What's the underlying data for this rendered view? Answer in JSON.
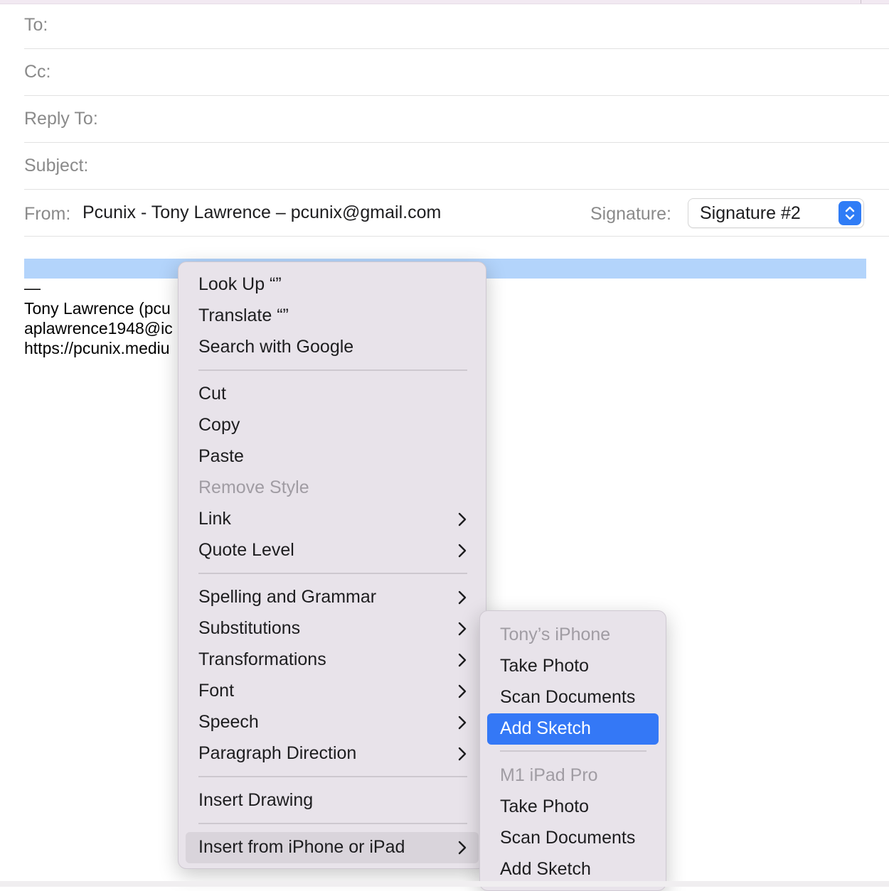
{
  "header": {
    "to_label": "To:",
    "cc_label": "Cc:",
    "reply_to_label": "Reply To:",
    "subject_label": "Subject:",
    "from_label": "From:",
    "from_value": "Pcunix - Tony Lawrence – pcunix@gmail.com",
    "signature_label": "Signature:",
    "signature_value": "Signature #2"
  },
  "body": {
    "dash": "—",
    "line1": "Tony Lawrence (pcu",
    "line2": "aplawrence1948@ic",
    "line3": "https://pcunix.mediu"
  },
  "context_menu": {
    "look_up": "Look Up “”",
    "translate": "Translate “”",
    "search_google": "Search with Google",
    "cut": "Cut",
    "copy": "Copy",
    "paste": "Paste",
    "remove_style": "Remove Style",
    "link": "Link",
    "quote_level": "Quote Level",
    "spelling": "Spelling and Grammar",
    "substitutions": "Substitutions",
    "transformations": "Transformations",
    "font": "Font",
    "speech": "Speech",
    "paragraph_direction": "Paragraph Direction",
    "insert_drawing": "Insert Drawing",
    "insert_iphone": "Insert from iPhone or iPad"
  },
  "submenu": {
    "device1": "Tony’s iPhone",
    "d1_take_photo": "Take Photo",
    "d1_scan": "Scan Documents",
    "d1_sketch": "Add Sketch",
    "device2": "M1 iPad Pro",
    "d2_take_photo": "Take Photo",
    "d2_scan": "Scan Documents",
    "d2_sketch": "Add Sketch"
  },
  "colors": {
    "accent": "#3478f6",
    "selection": "#b3d4fb",
    "menu_bg": "#e8e3ea"
  }
}
